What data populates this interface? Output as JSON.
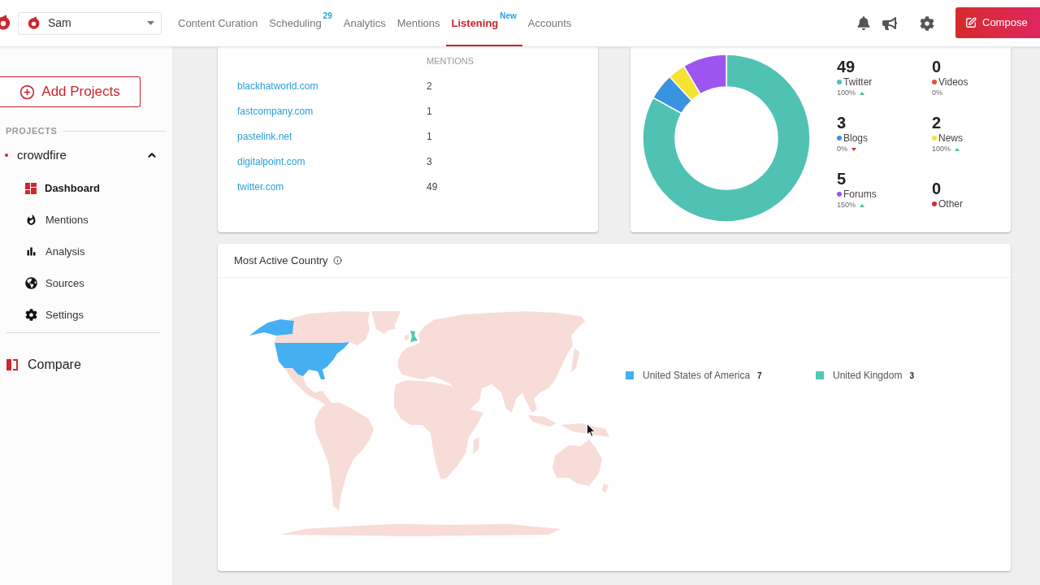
{
  "top_bar": {
    "account": {
      "name": "Sam"
    },
    "nav": [
      {
        "label": "Content Curation",
        "selected": false
      },
      {
        "label": "Scheduling",
        "badge": "29",
        "selected": false
      },
      {
        "label": "Analytics",
        "selected": false
      },
      {
        "label": "Mentions",
        "selected": false
      },
      {
        "label": "Listening",
        "badge": "New",
        "selected": true
      },
      {
        "label": "Accounts",
        "selected": false
      }
    ],
    "compose_button": "Compose"
  },
  "sidebar": {
    "add_button": "Add Projects",
    "section_label": "PROJECTS",
    "projects": [
      {
        "name": "crowdfire",
        "expanded": true,
        "children": [
          {
            "label": "Dashboard",
            "selected": true
          },
          {
            "label": "Mentions",
            "selected": false
          },
          {
            "label": "Analysis",
            "selected": false
          },
          {
            "label": "Sources",
            "selected": false
          },
          {
            "label": "Settings",
            "selected": false
          }
        ]
      }
    ],
    "compare": "Compare"
  },
  "sources_table": {
    "heading": "MENTIONS",
    "rows": [
      {
        "domain": "blackhatworld.com",
        "mentions": "2"
      },
      {
        "domain": "fastcompany.com",
        "mentions": "1"
      },
      {
        "domain": "pastelink.net",
        "mentions": "1"
      },
      {
        "domain": "digitalpoint.com",
        "mentions": "3"
      },
      {
        "domain": "twitter.com",
        "mentions": "49"
      }
    ]
  },
  "source_types": {
    "chart_data": {
      "type": "donut",
      "values": [
        83.05,
        0,
        5.08,
        3.39,
        8.48,
        0
      ]
    },
    "items": [
      {
        "count": "49",
        "label": "Twitter",
        "color": "#50c2b4",
        "change": "100%",
        "trend_up": true,
        "trend_down": false
      },
      {
        "count": "0",
        "label": "Videos",
        "color": "#e0533a",
        "change": "0%",
        "trend_up": false,
        "trend_down": false
      },
      {
        "count": "3",
        "label": "Blogs",
        "color": "#3a93e0",
        "change": "0%",
        "trend_up": false,
        "trend_down": true
      },
      {
        "count": "2",
        "label": "News",
        "color": "#f5e333",
        "change": "100%",
        "trend_up": true,
        "trend_down": false
      },
      {
        "count": "5",
        "label": "Forums",
        "color": "#9d55f0",
        "change": "150%",
        "trend_up": true,
        "trend_down": false
      },
      {
        "count": "0",
        "label": "Other",
        "color": "#d62a2a"
      }
    ]
  },
  "country_map": {
    "title": "Most Active Country",
    "legend": [
      {
        "country": "United States of America",
        "count": "7",
        "color": "#44b0f2"
      },
      {
        "country": "United Kingdom",
        "count": "3",
        "color": "#52c6b2"
      }
    ]
  }
}
